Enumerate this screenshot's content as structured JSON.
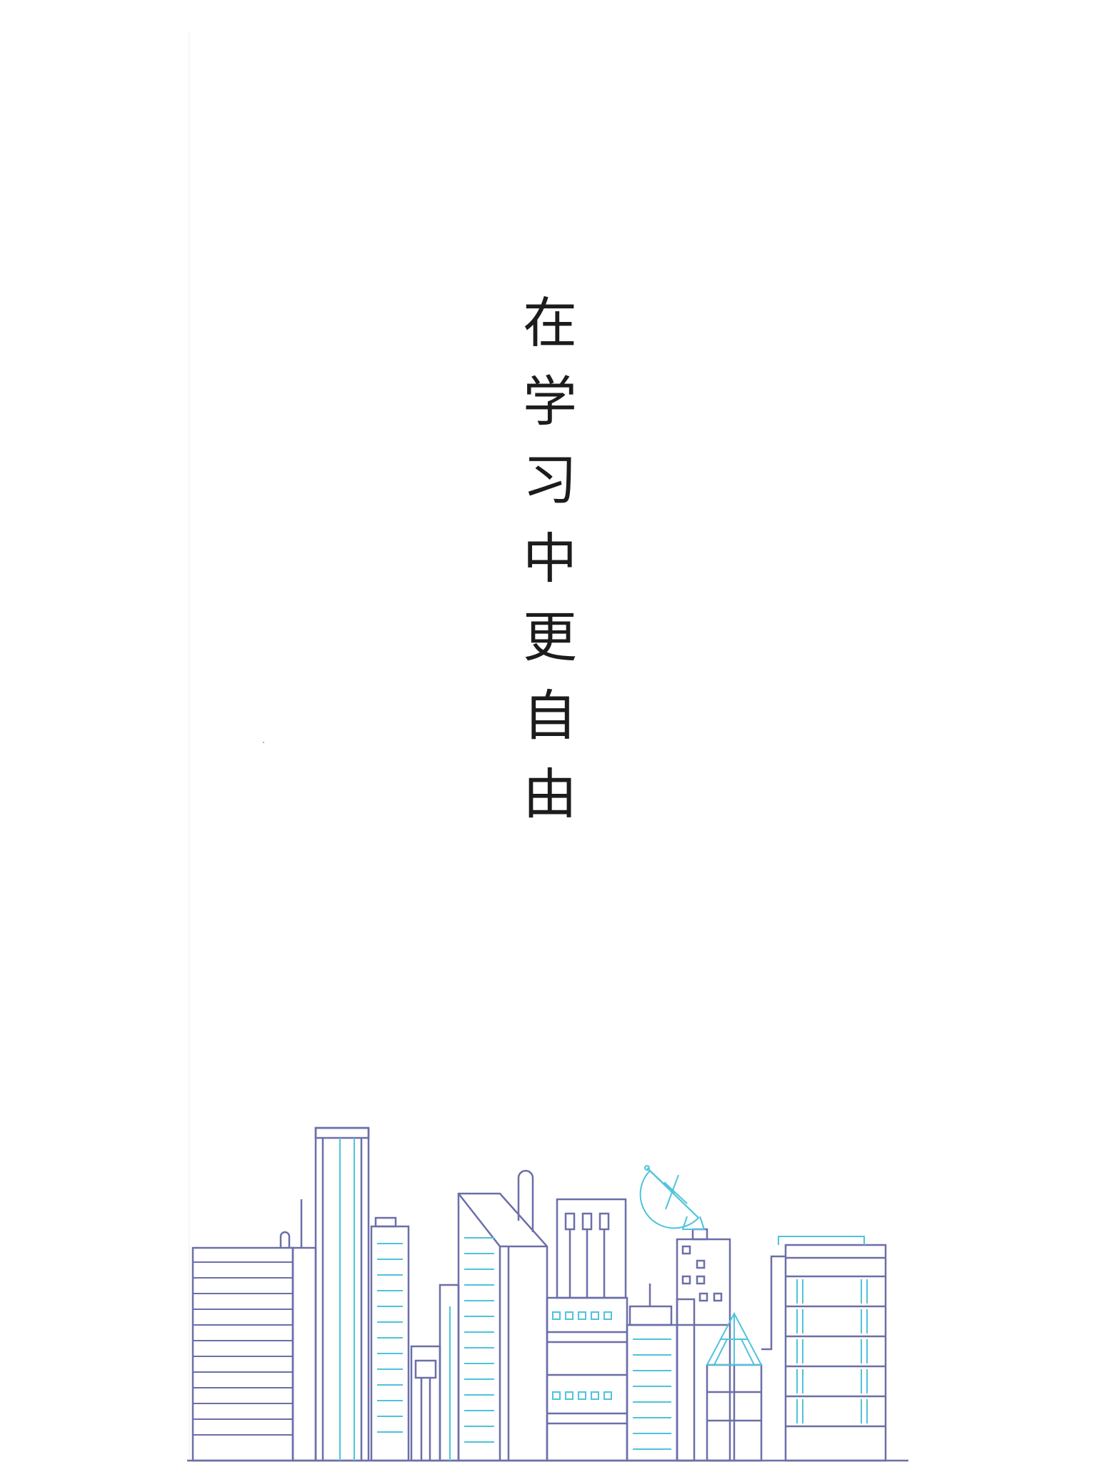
{
  "tagline": {
    "chars": [
      "在",
      "学",
      "习",
      "中",
      "更",
      "自",
      "由"
    ]
  },
  "illustration": {
    "icon": "cityscape-illustration",
    "colors": {
      "outline": "#6b6fa8",
      "accent": "#4fc3dc"
    }
  }
}
